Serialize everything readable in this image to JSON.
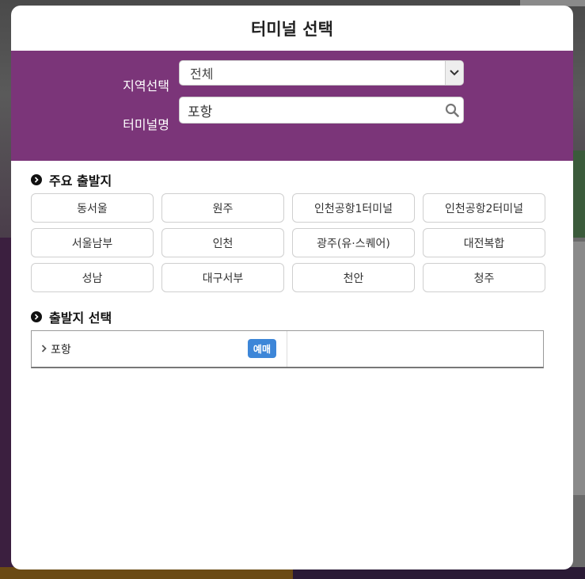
{
  "modal": {
    "title": "터미널 선택"
  },
  "search": {
    "region_label": "지역선택",
    "region_value": "전체",
    "terminal_label": "터미널명",
    "terminal_value": "포항"
  },
  "major_departures": {
    "heading": "주요 출발지",
    "items": [
      "동서울",
      "원주",
      "인천공항1터미널",
      "인천공항2터미널",
      "서울남부",
      "인천",
      "광주(유·스퀘어)",
      "대전복합",
      "성남",
      "대구서부",
      "천안",
      "청주"
    ]
  },
  "departure_select": {
    "heading": "출발지 선택",
    "results": [
      {
        "name": "포항",
        "badge": "예매"
      }
    ]
  },
  "colors": {
    "accent_purple": "#7b3579",
    "badge_blue": "#3d86d8"
  }
}
